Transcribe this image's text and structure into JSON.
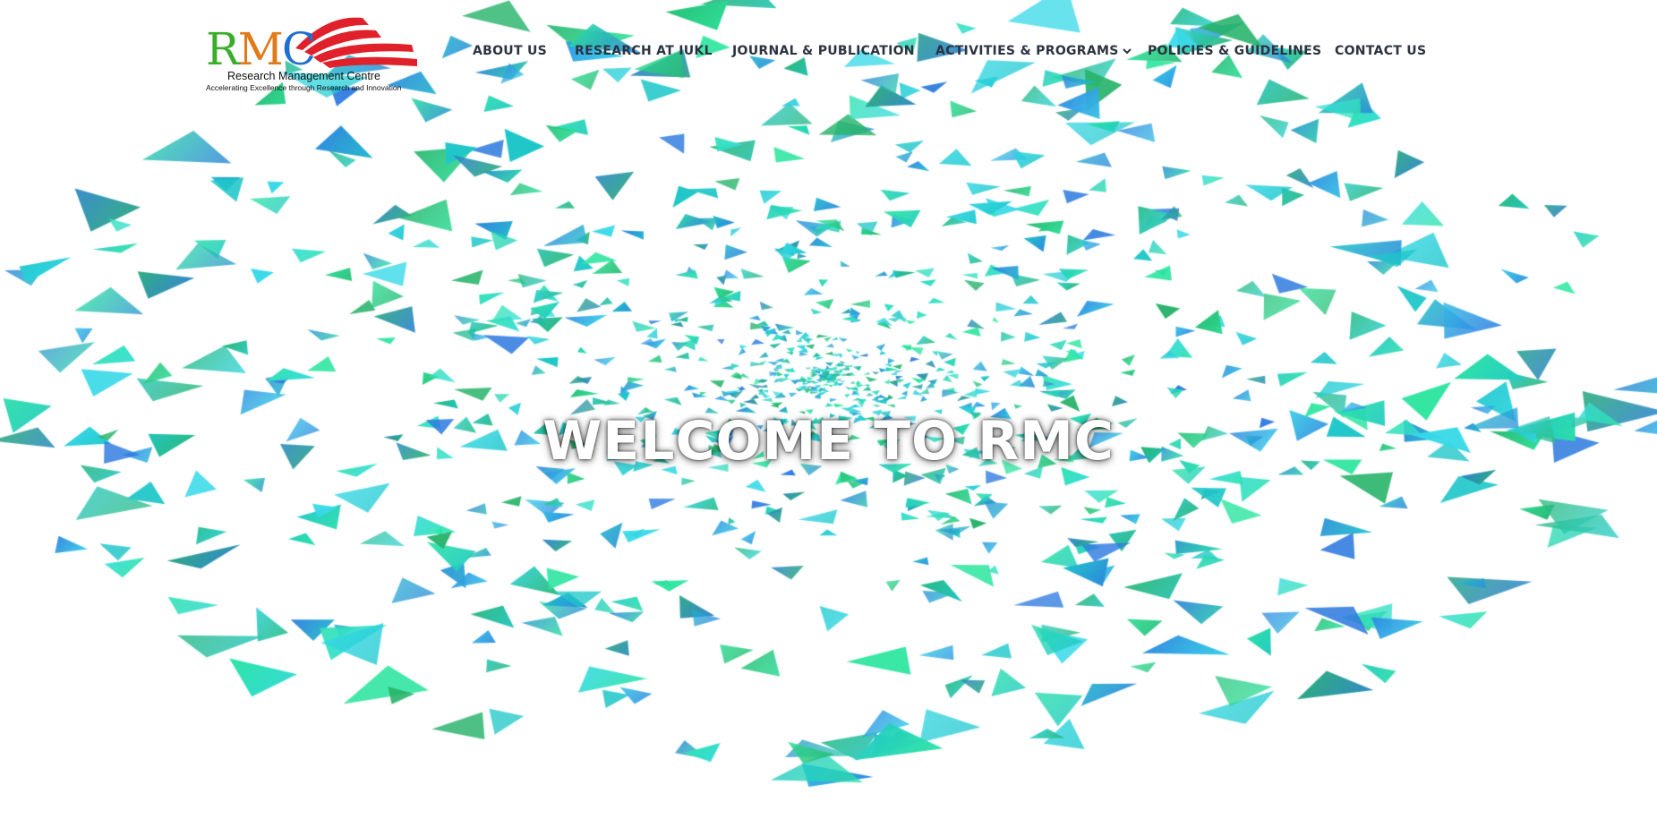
{
  "brand": {
    "logo_letters": [
      "R",
      "M",
      "C"
    ],
    "name": "Research Management Centre",
    "tagline": "Accelerating Excellence through Research and Innovation",
    "colors": {
      "r": "#3aae2a",
      "m": "#e07a1a",
      "c": "#1f6fd0",
      "book": "#e0202a"
    }
  },
  "nav": {
    "items": [
      {
        "label": "ABOUT US"
      },
      {
        "label": "RESEARCH AT IUKL"
      },
      {
        "label": "JOURNAL & PUBLICATION"
      },
      {
        "label": "ACTIVITIES & PROGRAMS",
        "icon": "chevron-down-icon"
      },
      {
        "label": "POLICIES & GUIDELINES"
      },
      {
        "label": "CONTACT US"
      }
    ]
  },
  "hero": {
    "title": "WELCOME TO RMC",
    "particle_colors": [
      "#2ee6a0",
      "#1fc7c9",
      "#2f7be0",
      "#27b36a",
      "#38d9e8"
    ]
  }
}
